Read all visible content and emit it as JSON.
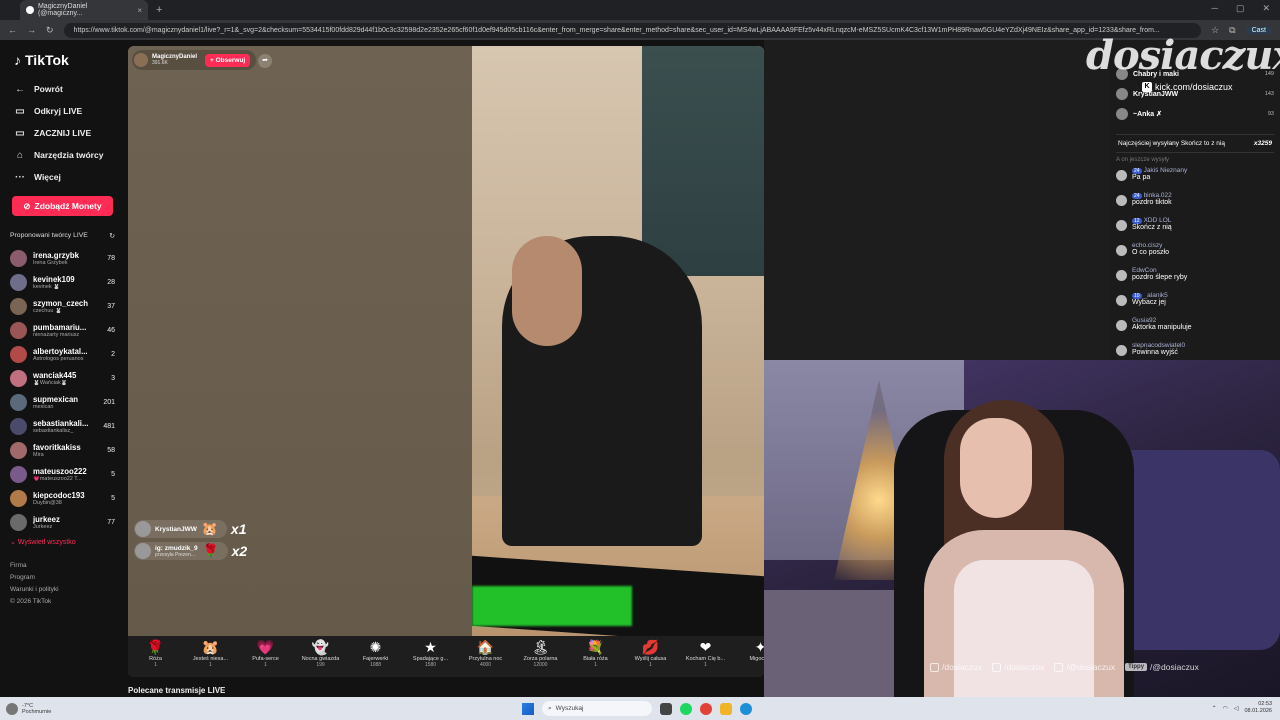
{
  "browser": {
    "tab_title": "MagicznyDaniel (@magiczny...",
    "url": "https://www.tiktok.com/@magicznydaniel1/live?_r=1&_svg=2&checksum=5534415f00fdd829d44f1b0c3c32598d2e2352e265cf60f1d0ef945d05cb116c&enter_from_merge=share&enter_method=share&sec_user_id=MS4wLjABAAAA9FEfz5v44xRLnqzcM-eMSZ5SUcmK4C3cf13W1mPH89Rnaw5GU4eYZdXj49NEIz&share_app_id=1233&share_from...",
    "cast_label": "Cast"
  },
  "tiktok": {
    "logo": "TikTok",
    "nav": [
      {
        "icon": "←",
        "label": "Powrót"
      },
      {
        "icon": "▭",
        "label": "Odkryj LIVE"
      },
      {
        "icon": "▭",
        "label": "ZACZNIJ LIVE"
      },
      {
        "icon": "⌂",
        "label": "Narzędzia twórcy"
      },
      {
        "icon": "···",
        "label": "Więcej"
      }
    ],
    "coins_button": "Zdobądź Monety",
    "suggested_title": "Proponowani twórcy LIVE",
    "creators": [
      {
        "name": "irena.grzybk",
        "sub": "Irena Grzybek",
        "count": "78",
        "color": "#8a5c6e"
      },
      {
        "name": "kevinek109",
        "sub": "kevinek 🐰",
        "count": "28",
        "color": "#6e6e8a"
      },
      {
        "name": "szymon_czech",
        "sub": "czechuu 🐰",
        "count": "37",
        "color": "#7a6454"
      },
      {
        "name": "pumbamariu...",
        "sub": "nienażarty mariusz",
        "count": "46",
        "color": "#9a5656"
      },
      {
        "name": "albertoykatal...",
        "sub": "Astrologos peruanos",
        "count": "2",
        "color": "#b24a4a"
      },
      {
        "name": "wanciak445",
        "sub": "🐰Wańciak🐰",
        "count": "3",
        "color": "#c07080"
      },
      {
        "name": "supmexican",
        "sub": "mexican",
        "count": "201",
        "color": "#5a6a7a"
      },
      {
        "name": "sebastiankali...",
        "sub": "sebastiankalisz_",
        "count": "481",
        "color": "#4a4a6a"
      },
      {
        "name": "favoritkakiss",
        "sub": "Mira",
        "count": "58",
        "color": "#a06a6a"
      },
      {
        "name": "mateuszoo222",
        "sub": "💗mateuszoo22 T...",
        "count": "5",
        "color": "#7a5a8a"
      },
      {
        "name": "kiepcodoc193",
        "sub": "Duybin@38",
        "count": "5",
        "color": "#b07a4a"
      },
      {
        "name": "jurkeez",
        "sub": "Jurkeez",
        "count": "77",
        "color": "#6a6a6a"
      }
    ],
    "show_all": "Wyświetl wszystko",
    "footer": [
      "Firma",
      "Program",
      "Warunki i polityki",
      "© 2026 TikTok"
    ],
    "host": {
      "name": "MagicznyDaniel",
      "stats": "391.6K",
      "follow": "+ Obserwuj"
    },
    "gift_feed": [
      {
        "user": "KrystianJWW",
        "sub": "",
        "gift": "🐹",
        "mult": "x1"
      },
      {
        "user": "ig: zmudzik_9",
        "sub": "przesyła Prezen...",
        "gift": "🌹",
        "mult": "x2"
      }
    ],
    "gifts": [
      {
        "icon": "🌹",
        "name": "Róża",
        "price": "1"
      },
      {
        "icon": "🐹",
        "name": "Jesteś niesa...",
        "price": "1"
      },
      {
        "icon": "💗",
        "name": "Pufa-serce",
        "price": "1"
      },
      {
        "icon": "👻",
        "name": "Nocna gwiazda",
        "price": "199"
      },
      {
        "icon": "✺",
        "name": "Fajerwerki",
        "price": "1088"
      },
      {
        "icon": "★",
        "name": "Spadające g...",
        "price": "1580"
      },
      {
        "icon": "🏠",
        "name": "Przytulna noc",
        "price": "4000"
      },
      {
        "icon": "🏝",
        "name": "Zorza polarna",
        "price": "12000"
      },
      {
        "icon": "💐",
        "name": "Biała róża",
        "price": "1"
      },
      {
        "icon": "💋",
        "name": "Wyślij całusa",
        "price": "1"
      },
      {
        "icon": "❤",
        "name": "Kocham Cię b...",
        "price": "1"
      },
      {
        "icon": "✦",
        "name": "Migocz...",
        "price": ""
      }
    ],
    "recommended": "Polecane transmisje LIVE"
  },
  "chat": {
    "ranking": [
      {
        "name": "Chabry i maki",
        "score": "149"
      },
      {
        "name": "KrystianJWW",
        "score": "143"
      },
      {
        "name": "~Anka ✗",
        "score": "93"
      }
    ],
    "top_gift_label": "Najczęściej wysyłany Skończ to z nią",
    "top_gift_count": "x3259",
    "faded_line": "A on jeszcze wysyły",
    "messages": [
      {
        "user": "Jakiś Nieznany",
        "level": "24",
        "text": "Pa pa"
      },
      {
        "user": "binka.022",
        "level": "24",
        "text": "pozdro tiktok"
      },
      {
        "user": "XDD LOL",
        "level": "12",
        "text": "Skończ z nią"
      },
      {
        "user": "echo.ciszy",
        "level": "",
        "text": "O co poszło"
      },
      {
        "user": "EdwCon",
        "level": "",
        "text": "pozdro ślepe ryby"
      },
      {
        "user": "_alanik5",
        "level": "10",
        "text": "Wybacz jej"
      },
      {
        "user": "Gusia92",
        "level": "",
        "text": "Aktorka manipuluje"
      },
      {
        "user": "slepnacodswiatel0",
        "level": "",
        "text": "Powinna wyjść"
      }
    ]
  },
  "overlay": {
    "brand": "dosiaczux",
    "kick": "kick.com/dosiaczux",
    "socials": [
      {
        "icon": "instagram-icon",
        "text": "/dosiaczux"
      },
      {
        "icon": "tiktok-icon",
        "text": "/dosiaczux"
      },
      {
        "icon": "youtube-icon",
        "text": "/@dosiaczux"
      },
      {
        "icon": "tippy-icon",
        "text": "/@dosiaczux"
      }
    ],
    "tippy_badge": "Tippy"
  },
  "taskbar": {
    "weather_temp": "-7°C",
    "weather_desc": "Pochmurnie",
    "search_placeholder": "Wyszukaj",
    "time": "02:53",
    "date": "08.01.2026"
  }
}
